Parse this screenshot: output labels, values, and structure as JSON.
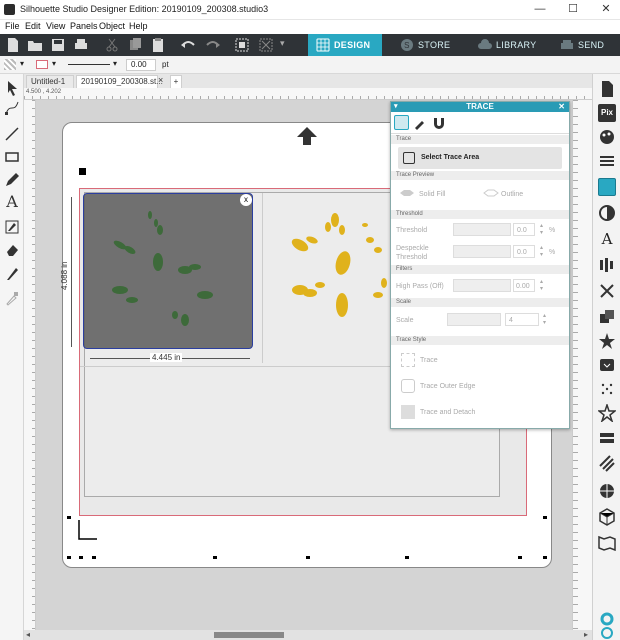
{
  "window": {
    "title": "Silhouette Studio Designer Edition: 20190109_200308.studio3",
    "minimize": "—",
    "maximize": "☐",
    "close": "✕"
  },
  "menu": [
    "File",
    "Edit",
    "View",
    "Panels",
    "Object",
    "Help"
  ],
  "nav_tabs": {
    "design": "DESIGN",
    "store": "STORE",
    "library": "LIBRARY",
    "send": "SEND"
  },
  "options_bar": {
    "line_width": "0.00",
    "unit": "pt"
  },
  "doc_tabs": {
    "tab1": "Untitled-1",
    "tab2": "20190109_200308.st...",
    "new_tab": "+"
  },
  "ruler": {
    "coordinates": "4.500 , 4.202"
  },
  "canvas": {
    "width_label": "4.445 in",
    "height_label": "4.088 in",
    "close_badge": "x"
  },
  "trace_panel": {
    "title": "TRACE",
    "close": "✕",
    "collapse": "▾",
    "sections": {
      "trace": "Trace",
      "preview": "Trace Preview",
      "threshold": "Threshold",
      "filters": "Filters",
      "scale": "Scale",
      "style": "Trace Style"
    },
    "select_area": "Select Trace Area",
    "solid_fill": "Solid Fill",
    "outline": "Outline",
    "threshold_label": "Threshold",
    "threshold_value": "0.0",
    "despeckle_label": "Despeckle\nThreshold",
    "despeckle_l1": "Despeckle",
    "despeckle_l2": "Threshold",
    "despeckle_value": "0.0",
    "percent": "%",
    "high_pass": "High Pass (Off)",
    "high_pass_value": "0.00",
    "scale_label": "Scale",
    "scale_value": "4",
    "trace_button": "Trace",
    "trace_outer": "Trace Outer Edge",
    "trace_detach": "Trace and Detach"
  },
  "colors": {
    "accent": "#29a8c2",
    "toolbar": "#2f3337",
    "mustard": "#e0b21c",
    "leaf_green": "#3d6a3a",
    "cut_border": "#d96a78"
  }
}
